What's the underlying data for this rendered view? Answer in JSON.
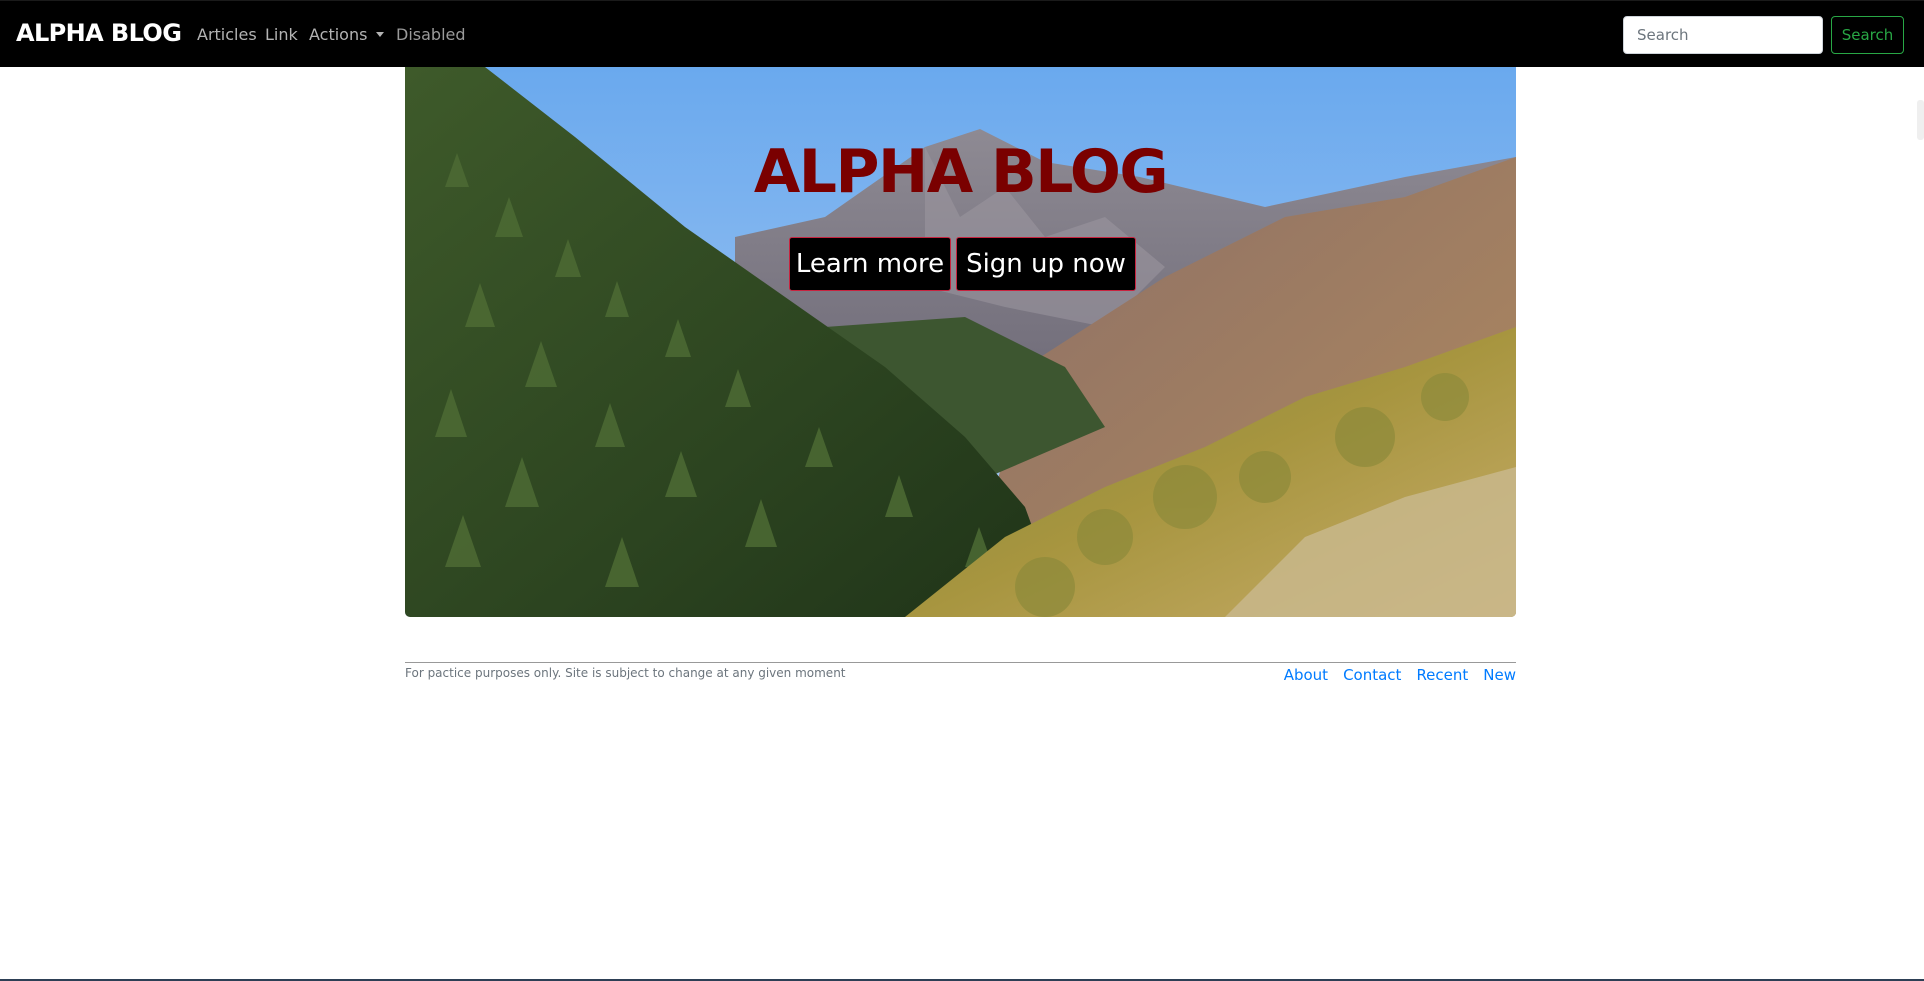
{
  "navbar": {
    "brand": "ALPHA BLOG",
    "links": {
      "articles": "Articles",
      "link": "Link",
      "actions": "Actions",
      "disabled": "Disabled"
    },
    "search": {
      "placeholder": "Search",
      "button_label": "Search"
    }
  },
  "hero": {
    "title": "ALPHA BLOG",
    "buttons": {
      "learn_more": "Learn more",
      "sign_up": "Sign up now"
    }
  },
  "footer": {
    "note": "For pactice purposes only. Site is subject to change at any given moment",
    "links": {
      "about": "About",
      "contact": "Contact",
      "recent": "Recent",
      "new": "New"
    }
  },
  "colors": {
    "navbar_bg": "#000000",
    "hero_title": "#7a0000",
    "search_outline": "#28a745",
    "link_blue": "#007bff"
  },
  "icons": {
    "actions_menu": "caret-down-icon"
  }
}
